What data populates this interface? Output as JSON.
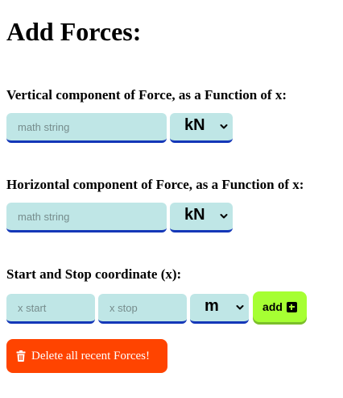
{
  "heading": "Add Forces:",
  "vertical": {
    "label": "Vertical component of Force, as a Function of x:",
    "input_placeholder": "math string",
    "unit_selected": "kN",
    "unit_icon": "chevron-down-icon"
  },
  "horizontal": {
    "label": "Horizontal component of Force, as a Function of x:",
    "input_placeholder": "math string",
    "unit_selected": "kN",
    "unit_icon": "chevron-down-icon"
  },
  "range": {
    "label": "Start and Stop coordinate (x):",
    "start_placeholder": "x start",
    "stop_placeholder": "x stop",
    "unit_selected": "m",
    "add_label": "add",
    "add_icon": "plus-square-icon"
  },
  "delete": {
    "label": "Delete all recent Forces!",
    "icon": "trash-icon"
  },
  "colors": {
    "input_bg": "#bfe6e6",
    "input_underline": "#1437b8",
    "add_bg": "#a6ff33",
    "delete_bg": "#ff4400"
  }
}
